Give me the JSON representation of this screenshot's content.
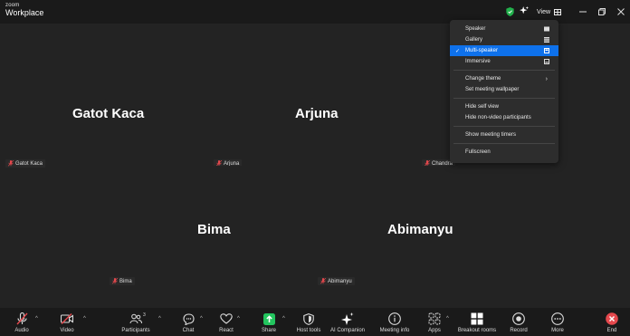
{
  "app": {
    "brand_top": "zoom",
    "brand_main": "Workplace"
  },
  "titlebar": {
    "view_label": "View"
  },
  "tiles": [
    {
      "name": "Gatot Kaca",
      "label": "Gatot Kaca"
    },
    {
      "name": "Arjuna",
      "label": "Arjuna"
    },
    {
      "name": "",
      "label": "Chandra"
    },
    {
      "name": "Bima",
      "label": "Bima"
    },
    {
      "name": "Abimanyu",
      "label": "Abimanyu"
    }
  ],
  "view_menu": {
    "layouts": [
      {
        "label": "Speaker",
        "icon": "speaker-layout-icon",
        "selected": false
      },
      {
        "label": "Gallery",
        "icon": "gallery-layout-icon",
        "selected": false
      },
      {
        "label": "Multi-speaker",
        "icon": "multi-speaker-layout-icon",
        "selected": true
      },
      {
        "label": "Immersive",
        "icon": "immersive-layout-icon",
        "selected": false
      }
    ],
    "change_theme": "Change theme",
    "set_wallpaper": "Set meeting wallpaper",
    "hide_self_view": "Hide self view",
    "hide_non_video": "Hide non-video participants",
    "show_timers": "Show meeting timers",
    "fullscreen": "Fullscreen"
  },
  "toolbar": {
    "audio": "Audio",
    "video": "Video",
    "participants": "Participants",
    "participants_count": "3",
    "chat": "Chat",
    "react": "React",
    "share": "Share",
    "host_tools": "Host tools",
    "ai_companion": "AI Companion",
    "meeting_info": "Meeting info",
    "apps": "Apps",
    "breakout_rooms": "Breakout rooms",
    "record": "Record",
    "more": "More",
    "end": "End"
  },
  "colors": {
    "accent": "#0e71eb",
    "share_green": "#23c55e",
    "end_red": "#e5484d",
    "shield_green": "#22b14c",
    "mic_off_red": "#e5484d"
  }
}
